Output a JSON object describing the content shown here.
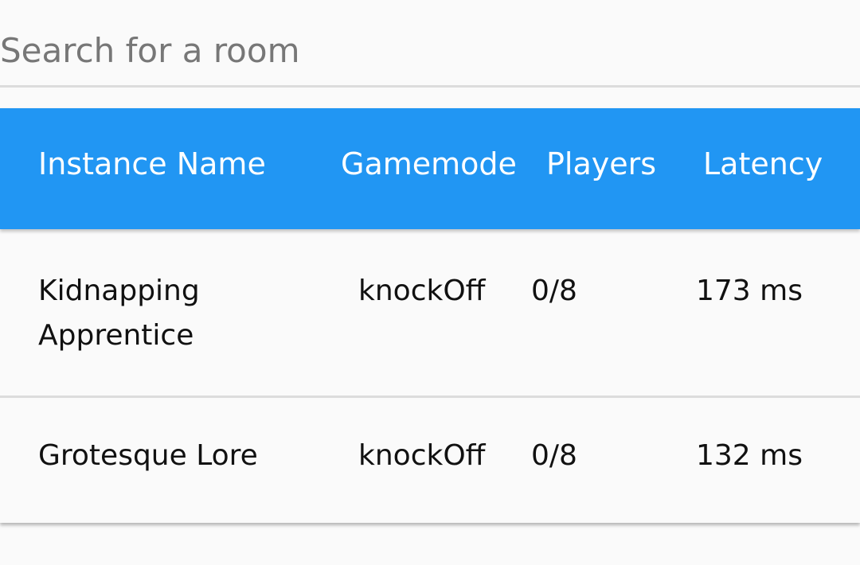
{
  "search": {
    "placeholder": "Search for a room"
  },
  "table": {
    "columns": [
      "Instance Name",
      "Gamemode",
      "Players",
      "Latency"
    ],
    "rows": [
      {
        "name": "Kidnapping Apprentice",
        "gamemode": "knockOff",
        "players": "0/8",
        "latency": "173 ms"
      },
      {
        "name": "Grotesque Lore",
        "gamemode": "knockOff",
        "players": "0/8",
        "latency": "132 ms"
      }
    ]
  },
  "colors": {
    "header_bg": "#2196f3",
    "header_text": "#ffffff",
    "page_bg": "#fafafa",
    "divider": "#dcdcdc"
  }
}
